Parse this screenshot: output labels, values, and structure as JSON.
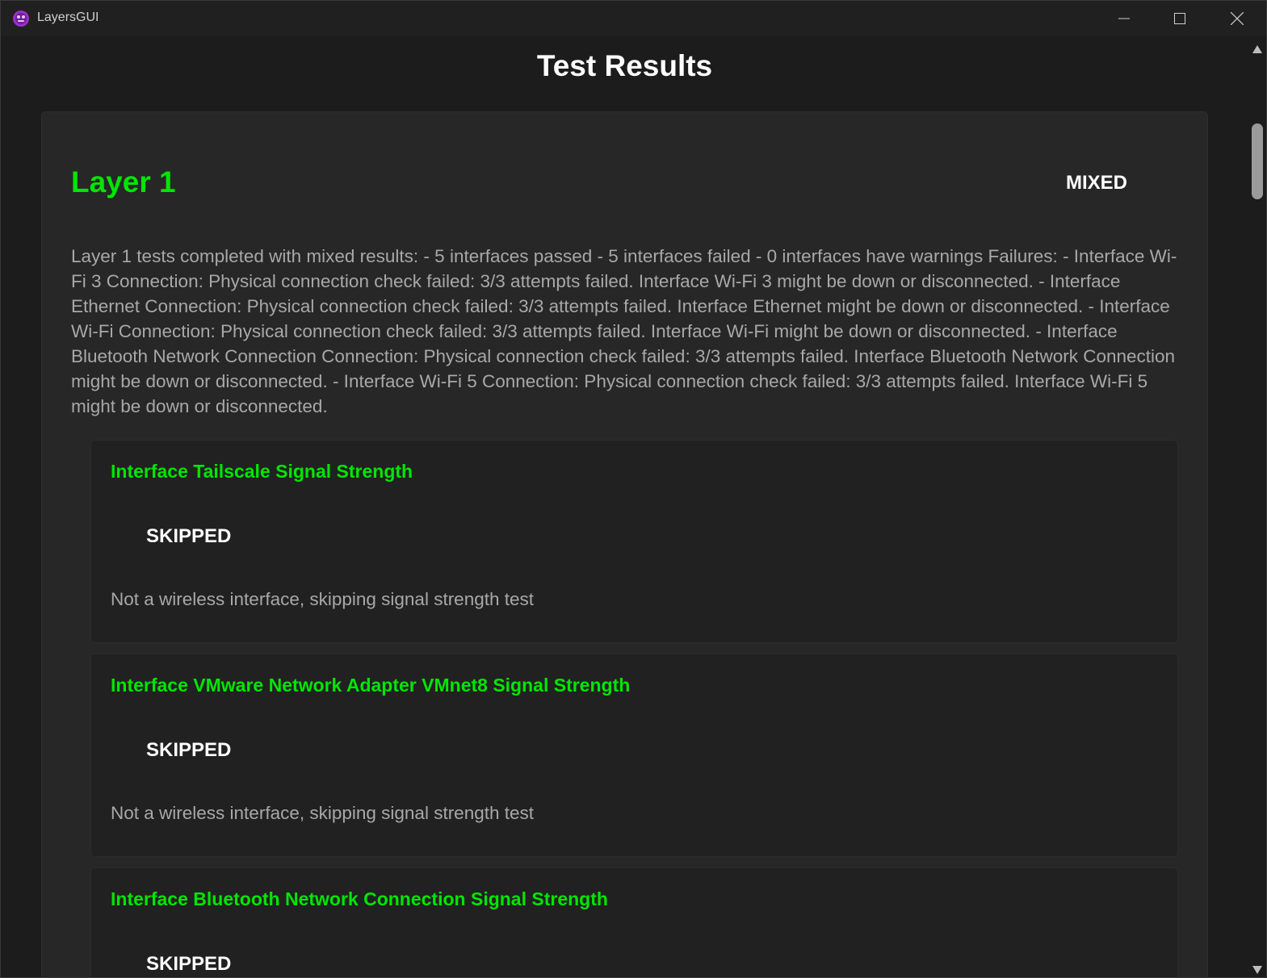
{
  "window": {
    "title": "LayersGUI"
  },
  "page": {
    "title": "Test Results"
  },
  "layer": {
    "title": "Layer 1",
    "status": "MIXED",
    "summary": "Layer 1 tests completed with mixed results: - 5 interfaces passed - 5 interfaces failed - 0 interfaces have warnings Failures: - Interface Wi-Fi 3 Connection: Physical connection check failed: 3/3 attempts failed. Interface Wi-Fi 3 might be down or disconnected. - Interface Ethernet Connection: Physical connection check failed: 3/3 attempts failed. Interface Ethernet might be down or disconnected. - Interface Wi-Fi Connection: Physical connection check failed: 3/3 attempts failed. Interface Wi-Fi might be down or disconnected. - Interface Bluetooth Network Connection Connection: Physical connection check failed: 3/3 attempts failed. Interface Bluetooth Network Connection might be down or disconnected. - Interface Wi-Fi 5 Connection: Physical connection check failed: 3/3 attempts failed. Interface Wi-Fi 5 might be down or disconnected.",
    "tests": [
      {
        "name": "Interface Tailscale Signal Strength",
        "status": "SKIPPED",
        "message": "Not a wireless interface, skipping signal strength test"
      },
      {
        "name": "Interface VMware Network Adapter VMnet8 Signal Strength",
        "status": "SKIPPED",
        "message": "Not a wireless interface, skipping signal strength test"
      },
      {
        "name": "Interface Bluetooth Network Connection Signal Strength",
        "status": "SKIPPED",
        "message": ""
      }
    ]
  },
  "colors": {
    "pass_green": "#00e600",
    "background": "#1c1c1c",
    "card": "#272727",
    "test_card": "#212121",
    "muted_text": "#a8a8a8"
  },
  "icons": {
    "app": "app-logo-icon",
    "minimize": "minimize-icon",
    "maximize": "maximize-icon",
    "close": "close-icon",
    "scroll_up": "scroll-up-arrow-icon",
    "scroll_down": "scroll-down-arrow-icon"
  }
}
